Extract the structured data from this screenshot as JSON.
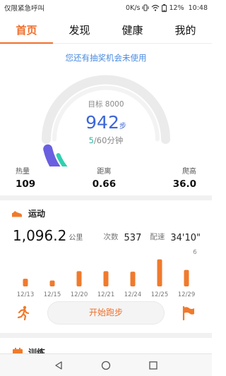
{
  "status_bar": {
    "carrier_text": "仅限紧急呼叫",
    "network_speed": "0K/s",
    "battery": "12%",
    "time": "10:48"
  },
  "tabs": [
    {
      "label": "首页",
      "active": true
    },
    {
      "label": "发现",
      "active": false
    },
    {
      "label": "健康",
      "active": false
    },
    {
      "label": "我的",
      "active": false
    }
  ],
  "lottery_notice": "您还有抽奖机会未使用",
  "daily": {
    "goal_label": "目标 8000",
    "steps": "942",
    "steps_unit": "步",
    "steps_progress": 0.118,
    "active_minutes_done": "5",
    "active_minutes_total": "/60分钟",
    "minutes_progress": 0.083
  },
  "stats": [
    {
      "label": "热量",
      "value": "109"
    },
    {
      "label": "距离",
      "value": "0.66"
    },
    {
      "label": "爬高",
      "value": "36.0"
    }
  ],
  "sport": {
    "title": "运动",
    "distance": "1,096.2",
    "distance_unit": "公里",
    "count_label": "次数",
    "count_value": "537",
    "pace_label": "配速",
    "pace_value": "34'10\"",
    "start_button": "开始跑步"
  },
  "chart_data": {
    "type": "bar",
    "categories": [
      "12/13",
      "12/15",
      "12/20",
      "12/21",
      "12/24",
      "12/25",
      "12/29"
    ],
    "values": [
      1.3,
      1.0,
      2.6,
      2.6,
      2.5,
      4.6,
      2.8
    ],
    "max_label": "6",
    "ylim": [
      0,
      6
    ],
    "color": "#f07a2c",
    "grid": false
  },
  "training": {
    "title": "训练"
  },
  "colors": {
    "accent": "#ef6f2b",
    "link": "#4a8be0",
    "steps_blue": "#3c67d8",
    "gauge_purple": "#6a5fe0",
    "gauge_teal": "#2fd0b0"
  }
}
